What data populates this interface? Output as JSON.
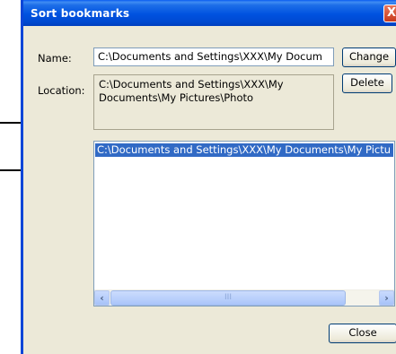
{
  "dialog": {
    "title": "Sort bookmarks",
    "close_glyph": "X"
  },
  "name": {
    "label": "Name:",
    "value": "C:\\Documents and Settings\\XXX\\My Docum"
  },
  "location": {
    "label": "Location:",
    "line1": "C:\\Documents and Settings\\XXX\\My",
    "line2": "Documents\\My Pictures\\Photo"
  },
  "buttons": {
    "change": "Change",
    "delete": "Delete",
    "close": "Close"
  },
  "bookmarks": {
    "items": [
      "C:\\Documents and Settings\\XXX\\My Documents\\My Pictu"
    ]
  },
  "scrollbar": {
    "left_glyph": "‹",
    "right_glyph": "›",
    "thumb_grip": "III"
  },
  "colors": {
    "titlebar": "#0054e3",
    "selection": "#316ac5",
    "dialog_face": "#ece9d8"
  }
}
